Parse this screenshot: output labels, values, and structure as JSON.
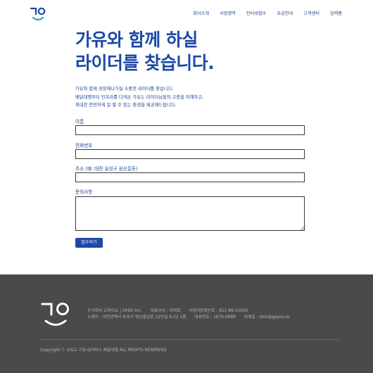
{
  "header": {
    "nav": [
      "회사소개",
      "사업영역",
      "인터넷접수",
      "요금안내",
      "고객센터",
      "입력폼"
    ]
  },
  "hero": {
    "title_line1": "가유와 함께 하실",
    "title_line2": "라이더를 찾습니다.",
    "intro": [
      "가유와 함께 성장해나가실 소중한 라이더를 찾습니다.",
      "배달대행부터 인프라를 다져온 가유는 라이더님들의 고충을 이해하고,",
      "최대한 안전하게 일 할 수 있는 환경을 제공해드립니다."
    ]
  },
  "form": {
    "name_label": "이름",
    "phone_label": "전화번호",
    "address_label": "주소 (예: 대전 유성구 원신흥동)",
    "inquiry_label": "문의사항",
    "submit_label": "접수하기"
  },
  "footer": {
    "company": "주식회사 오하이오 | OHIO Inc.",
    "ceo": "대표이사 : 이대희",
    "biz_no": "사업자등록번호 : 811-86-01820",
    "address": "소재지 : 대전광역시 유성구 원신흥남로 11번길 6-22 1층",
    "tel": "대표번호 : 1670-0889",
    "email": "이메일 : ohio@gayou.kr",
    "copyright": "Copyright ⓒ 2022 가유-Q커머스 배달대행 ALL RIGHTS RESERVED"
  },
  "colors": {
    "brand": "#1d48a8",
    "text": "#1a3f8f",
    "footer_bg": "#4a4a4a",
    "footer_text": "#b9b9b9"
  },
  "icons": {
    "logo": "gayou-smile-logo"
  }
}
